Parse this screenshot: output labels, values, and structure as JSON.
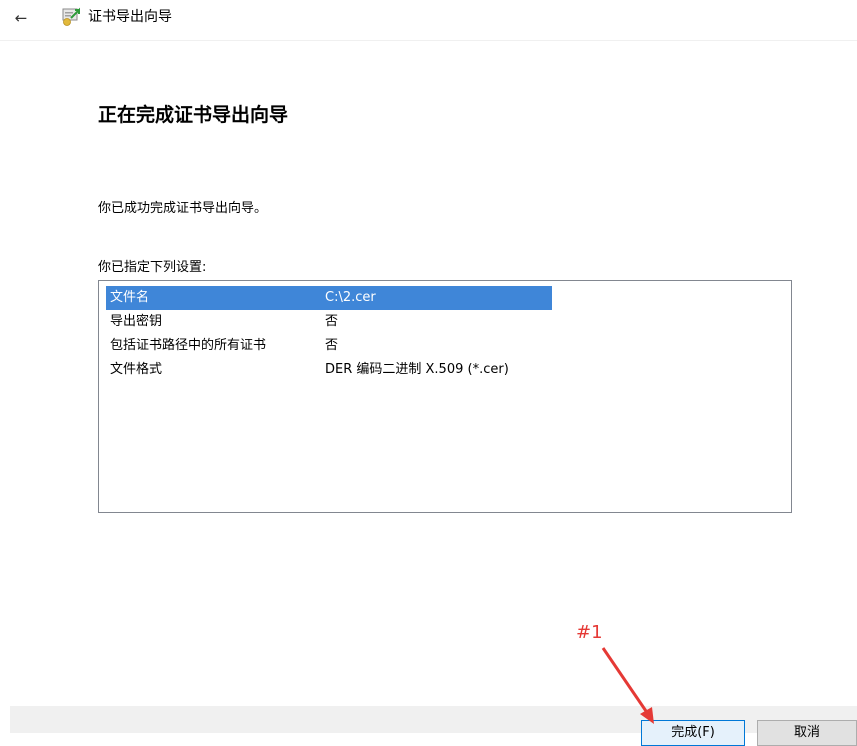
{
  "window": {
    "title": "证书导出向导",
    "back_icon": "←"
  },
  "page": {
    "heading": "正在完成证书导出向导",
    "message": "你已成功完成证书导出向导。",
    "settings_label": "你已指定下列设置:"
  },
  "settings": [
    {
      "key": "文件名",
      "value": "C:\\2.cer",
      "selected": true
    },
    {
      "key": "导出密钥",
      "value": "否",
      "selected": false
    },
    {
      "key": "包括证书路径中的所有证书",
      "value": "否",
      "selected": false
    },
    {
      "key": "文件格式",
      "value": "DER 编码二进制 X.509 (*.cer)",
      "selected": false
    }
  ],
  "buttons": {
    "finish": "完成(F)",
    "cancel": "取消"
  },
  "annotation": {
    "label": "#1"
  },
  "colors": {
    "selection": "#3f86d8",
    "annotation": "#e53935",
    "footer": "#f0f0f0"
  }
}
